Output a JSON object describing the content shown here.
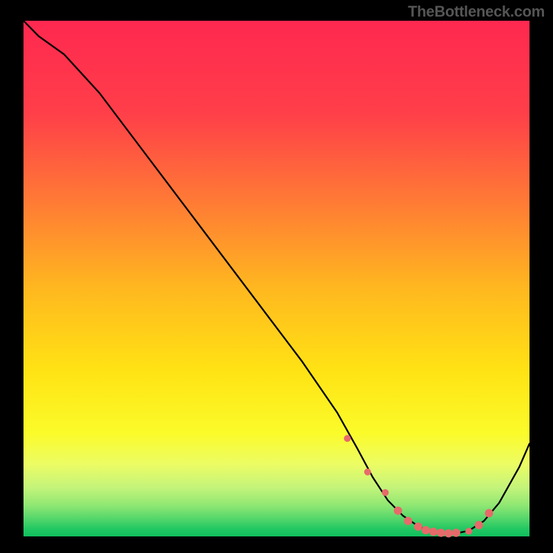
{
  "attribution": "TheBottleneck.com",
  "chart_data": {
    "type": "line",
    "title": "",
    "xlabel": "",
    "ylabel": "",
    "xlim": [
      0,
      100
    ],
    "ylim": [
      0,
      100
    ],
    "background_gradient_stops": [
      {
        "offset": 0.0,
        "color": "#ff2850"
      },
      {
        "offset": 0.18,
        "color": "#ff3f49"
      },
      {
        "offset": 0.35,
        "color": "#ff7a35"
      },
      {
        "offset": 0.52,
        "color": "#ffb81f"
      },
      {
        "offset": 0.68,
        "color": "#ffe314"
      },
      {
        "offset": 0.8,
        "color": "#fbfb2a"
      },
      {
        "offset": 0.86,
        "color": "#ecfc64"
      },
      {
        "offset": 0.905,
        "color": "#c4f47a"
      },
      {
        "offset": 0.94,
        "color": "#8fe773"
      },
      {
        "offset": 0.965,
        "color": "#55d76b"
      },
      {
        "offset": 0.985,
        "color": "#23c863"
      },
      {
        "offset": 1.0,
        "color": "#0fc05e"
      }
    ],
    "series": [
      {
        "name": "bottleneck-curve",
        "x": [
          0,
          3,
          8,
          15,
          25,
          35,
          45,
          55,
          62,
          66,
          69,
          72,
          75,
          78,
          80,
          82,
          84,
          86,
          88,
          91,
          94,
          98,
          100
        ],
        "values": [
          100,
          97,
          93.5,
          86,
          73,
          60,
          47,
          34,
          24,
          17,
          11.5,
          7,
          4,
          2,
          1.1,
          0.7,
          0.6,
          0.7,
          1.1,
          3,
          6.5,
          13.5,
          18
        ]
      }
    ],
    "markers": {
      "name": "highlight-points",
      "color": "#e76a6a",
      "x": [
        64,
        68,
        71.5,
        74,
        76,
        78,
        79.5,
        81,
        82.5,
        84,
        85.5,
        88,
        90,
        92
      ],
      "values": [
        19,
        12.5,
        8.5,
        5,
        3,
        1.9,
        1.2,
        0.9,
        0.7,
        0.6,
        0.7,
        1.0,
        2.2,
        4.5
      ],
      "radius": [
        5,
        5,
        5,
        6,
        6,
        6,
        6,
        6,
        6,
        6,
        6,
        5,
        6,
        6
      ]
    }
  }
}
